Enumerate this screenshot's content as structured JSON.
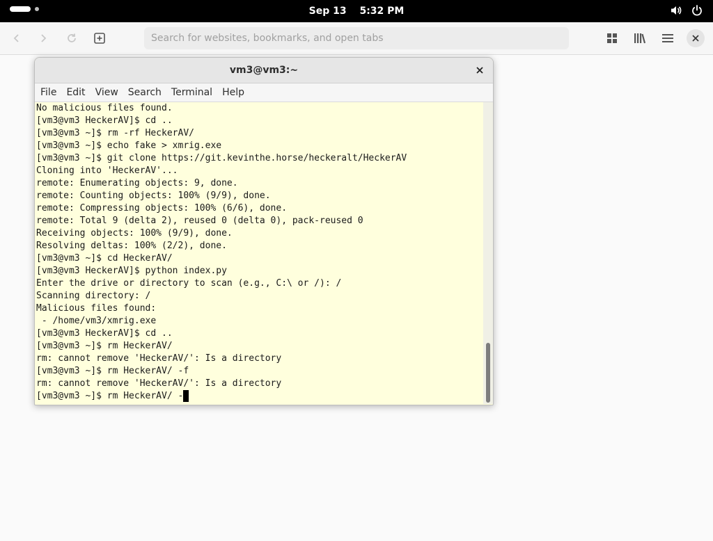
{
  "topbar": {
    "date": "Sep 13",
    "time": "5:32 PM",
    "icons": [
      "activities-indicator",
      "volume-icon",
      "power-icon"
    ]
  },
  "browser": {
    "search_placeholder": "Search for websites, bookmarks, and open tabs",
    "icons": [
      "back-arrow-icon",
      "forward-arrow-icon",
      "reload-icon",
      "new-tab-icon",
      "tab-overview-icon",
      "library-icon",
      "hamburger-menu-icon",
      "close-icon"
    ]
  },
  "terminal": {
    "title": "vm3@vm3:~",
    "menu": [
      "File",
      "Edit",
      "View",
      "Search",
      "Terminal",
      "Help"
    ],
    "lines": [
      "No malicious files found.",
      "[vm3@vm3 HeckerAV]$ cd ..",
      "[vm3@vm3 ~]$ rm -rf HeckerAV/",
      "[vm3@vm3 ~]$ echo fake > xmrig.exe",
      "[vm3@vm3 ~]$ git clone https://git.kevinthe.horse/heckeralt/HeckerAV",
      "Cloning into 'HeckerAV'...",
      "remote: Enumerating objects: 9, done.",
      "remote: Counting objects: 100% (9/9), done.",
      "remote: Compressing objects: 100% (6/6), done.",
      "remote: Total 9 (delta 2), reused 0 (delta 0), pack-reused 0",
      "Receiving objects: 100% (9/9), done.",
      "Resolving deltas: 100% (2/2), done.",
      "[vm3@vm3 ~]$ cd HeckerAV/",
      "[vm3@vm3 HeckerAV]$ python index.py",
      "Enter the drive or directory to scan (e.g., C:\\ or /): /",
      "Scanning directory: /",
      "Malicious files found:",
      " - /home/vm3/xmrig.exe",
      "[vm3@vm3 HeckerAV]$ cd ..",
      "[vm3@vm3 ~]$ rm HeckerAV/",
      "rm: cannot remove 'HeckerAV/': Is a directory",
      "[vm3@vm3 ~]$ rm HeckerAV/ -f",
      "rm: cannot remove 'HeckerAV/': Is a directory"
    ],
    "current_input": "[vm3@vm3 ~]$ rm HeckerAV/ -"
  }
}
